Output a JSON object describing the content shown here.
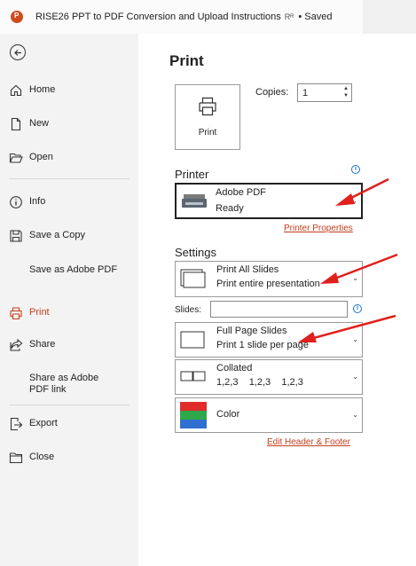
{
  "titlebar": {
    "document_title": "RISE26 PPT to PDF Conversion and Upload Instructions",
    "share_glyph": "Rᴿ",
    "status": "•  Saved"
  },
  "sidebar": {
    "items": [
      {
        "label": "Home"
      },
      {
        "label": "New"
      },
      {
        "label": "Open"
      },
      {
        "label": "Info"
      },
      {
        "label": "Save a Copy"
      },
      {
        "label": "Save as Adobe PDF"
      },
      {
        "label": "Print"
      },
      {
        "label": "Share"
      },
      {
        "label": "Share as Adobe PDF link"
      },
      {
        "label": "Export"
      },
      {
        "label": "Close"
      }
    ],
    "active": "Print"
  },
  "main": {
    "title": "Print",
    "print_button_label": "Print",
    "copies_label": "Copies:",
    "copies_value": "1",
    "printer": {
      "heading": "Printer",
      "name": "Adobe PDF",
      "status": "Ready",
      "properties_link": "Printer Properties"
    },
    "settings": {
      "heading": "Settings",
      "what": {
        "title": "Print All Slides",
        "subtitle": "Print entire presentation"
      },
      "slides_label": "Slides:",
      "slides_value": "",
      "layout": {
        "title": "Full Page Slides",
        "subtitle": "Print 1 slide per page"
      },
      "collation": {
        "title": "Collated",
        "subtitle": "1,2,3    1,2,3    1,2,3"
      },
      "color": {
        "title": "Color"
      },
      "header_footer_link": "Edit Header & Footer"
    }
  },
  "colors": {
    "accent": "#c43e1c",
    "annotation_arrow": "#e0201c",
    "info": "#1a73c9"
  }
}
